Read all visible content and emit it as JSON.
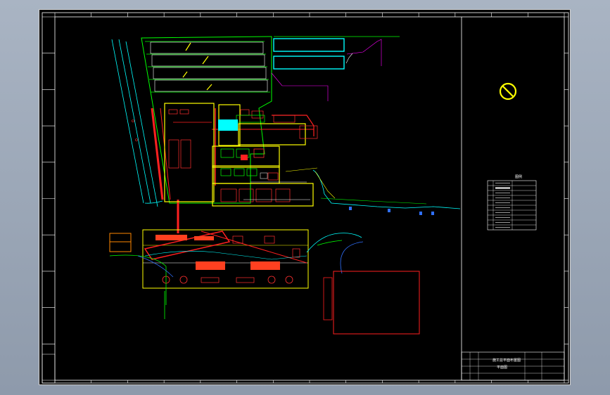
{
  "sheet": {
    "background": "#000000",
    "frame_color": "#ffffff",
    "colors": {
      "green": "#00ff00",
      "yellow": "#ffff00",
      "red": "#ff2020",
      "cyan": "#00ffff",
      "magenta": "#ff00ff",
      "blue": "#3070ff",
      "white": "#ffffff",
      "orange": "#ff8800"
    }
  },
  "legend": {
    "title": "图例",
    "rows": 10
  },
  "title_block": {
    "project": "施工总平面布置图",
    "drawing_no": "平面图"
  },
  "symbols": {
    "north_icon": "no-entry-circle-icon"
  }
}
